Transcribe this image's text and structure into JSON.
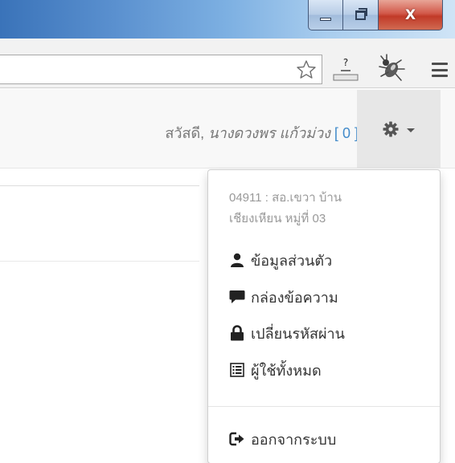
{
  "window": {
    "minimize_icon": "minimize-icon",
    "maximize_icon": "maximize-icon",
    "close_glyph": "X"
  },
  "browser": {
    "bookmark_icon": "star-icon",
    "extension_help_label": "?",
    "extension_bug_icon": "bug-icon",
    "menu_icon": "hamburger-menu-icon"
  },
  "navbar": {
    "greeting_prefix": "สวัสดี,",
    "user_name": "นางดวงพร แก้วม่วง",
    "count_open": "[",
    "notification_count": "0",
    "count_close": "]",
    "settings_icon": "gear-icon"
  },
  "dropdown": {
    "header_line1": "04911 : สอ.เขวา บ้าน",
    "header_line2": "เชียงเหียน หมู่ที่ 03",
    "items": [
      {
        "label": "ข้อมูลส่วนตัว",
        "icon": "user-icon"
      },
      {
        "label": "กล่องข้อความ",
        "icon": "comment-icon"
      },
      {
        "label": "เปลี่ยนรหัสผ่าน",
        "icon": "lock-icon"
      },
      {
        "label": "ผู้ใช้ทั้งหมด",
        "icon": "list-icon"
      }
    ],
    "logout": {
      "label": "ออกจากระบบ",
      "icon": "logout-icon"
    }
  },
  "colors": {
    "link_blue": "#428bca",
    "muted_text": "#777777",
    "navbar_bg": "#f8f8f8",
    "toggle_bg": "#e7e7e7"
  }
}
